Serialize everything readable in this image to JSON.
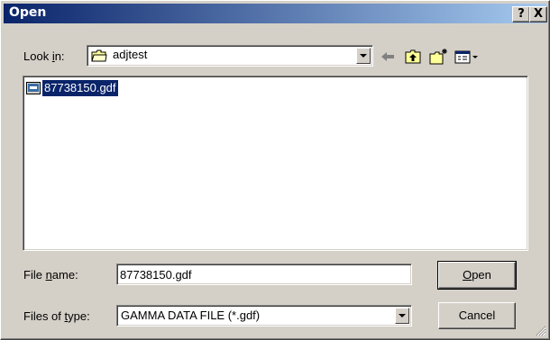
{
  "window": {
    "title": "Open",
    "help_glyph": "?",
    "close_glyph": "X"
  },
  "lookin": {
    "label_prefix": "Look ",
    "label_accel": "i",
    "label_suffix": "n:",
    "value": "adjtest",
    "icon": "folder-icon"
  },
  "toolbar": {
    "icons": [
      "back-arrow-icon",
      "up-folder-icon",
      "new-folder-icon",
      "view-menu-icon"
    ]
  },
  "files": [
    {
      "name": "87738150.gdf",
      "selected": true,
      "icon": "file-icon"
    }
  ],
  "filename": {
    "label_prefix": "File ",
    "label_accel": "n",
    "label_suffix": "ame:",
    "value": "87738150.gdf"
  },
  "filetype": {
    "label_prefix": "Files of ",
    "label_accel": "t",
    "label_suffix": "ype:",
    "value": "GAMMA DATA FILE (*.gdf)"
  },
  "buttons": {
    "open_accel": "O",
    "open_rest": "pen",
    "cancel": "Cancel"
  },
  "colors": {
    "titlebar_start": "#0a246a",
    "titlebar_end": "#a6caf0",
    "face": "#d4d0c8",
    "selection": "#0a246a"
  }
}
